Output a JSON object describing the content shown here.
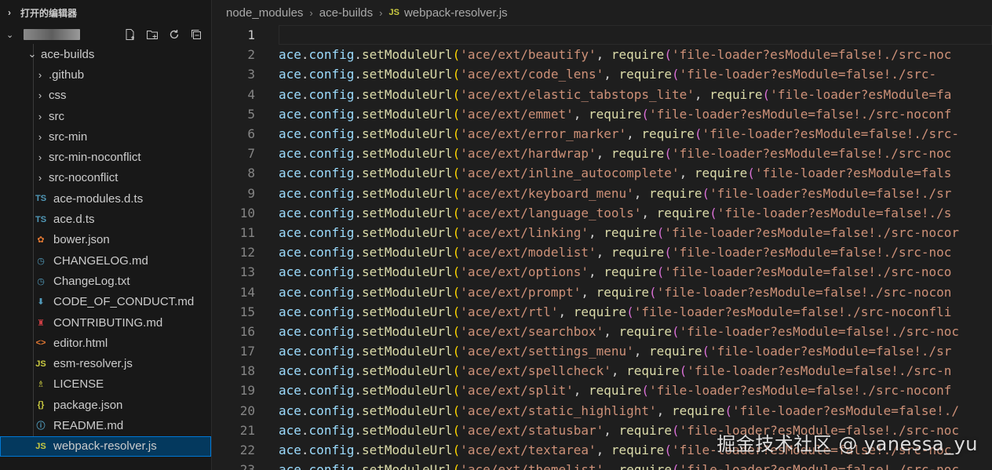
{
  "sidebar": {
    "section_title": "打开的编辑器",
    "actions": [
      "new-file-icon",
      "new-folder-icon",
      "refresh-icon",
      "collapse-all-icon"
    ],
    "folder": "ace-builds",
    "items": [
      {
        "label": ".github",
        "type": "folder"
      },
      {
        "label": "css",
        "type": "folder"
      },
      {
        "label": "src",
        "type": "folder"
      },
      {
        "label": "src-min",
        "type": "folder"
      },
      {
        "label": "src-min-noconflict",
        "type": "folder"
      },
      {
        "label": "src-noconflict",
        "type": "folder"
      },
      {
        "label": "ace-modules.d.ts",
        "type": "ts",
        "icon": "TS",
        "color": "#519aba"
      },
      {
        "label": "ace.d.ts",
        "type": "ts",
        "icon": "TS",
        "color": "#519aba"
      },
      {
        "label": "bower.json",
        "type": "bower",
        "icon": "✿",
        "color": "#e37933"
      },
      {
        "label": "CHANGELOG.md",
        "type": "changelog",
        "icon": "◷",
        "color": "#519aba"
      },
      {
        "label": "ChangeLog.txt",
        "type": "changelog",
        "icon": "◷",
        "color": "#519aba"
      },
      {
        "label": "CODE_OF_CONDUCT.md",
        "type": "conduct",
        "icon": "⬇",
        "color": "#519aba"
      },
      {
        "label": "CONTRIBUTING.md",
        "type": "contrib",
        "icon": "♜",
        "color": "#cc3e44"
      },
      {
        "label": "editor.html",
        "type": "html",
        "icon": "<>",
        "color": "#e37933"
      },
      {
        "label": "esm-resolver.js",
        "type": "js",
        "icon": "JS",
        "color": "#cbcb41"
      },
      {
        "label": "LICENSE",
        "type": "license",
        "icon": "♗",
        "color": "#cbcb41"
      },
      {
        "label": "package.json",
        "type": "json",
        "icon": "{}",
        "color": "#cbcb41"
      },
      {
        "label": "README.md",
        "type": "info",
        "icon": "ⓘ",
        "color": "#519aba"
      },
      {
        "label": "webpack-resolver.js",
        "type": "js",
        "icon": "JS",
        "color": "#cbcb41",
        "selected": true
      }
    ]
  },
  "breadcrumb": [
    "node_modules",
    "ace-builds",
    "webpack-resolver.js"
  ],
  "editor": {
    "active_line": 1,
    "lines": [
      {
        "n": "1",
        "path": ""
      },
      {
        "n": "2",
        "path": "'ace/ext/beautify'",
        "tail": "'file-loader?esModule=false!./src-noc"
      },
      {
        "n": "3",
        "path": "'ace/ext/code_lens'",
        "tail": "'file-loader?esModule=false!./src-"
      },
      {
        "n": "4",
        "path": "'ace/ext/elastic_tabstops_lite'",
        "tail": "'file-loader?esModule=fa"
      },
      {
        "n": "5",
        "path": "'ace/ext/emmet'",
        "tail": "'file-loader?esModule=false!./src-noconf"
      },
      {
        "n": "6",
        "path": "'ace/ext/error_marker'",
        "tail": "'file-loader?esModule=false!./src-"
      },
      {
        "n": "7",
        "path": "'ace/ext/hardwrap'",
        "tail": "'file-loader?esModule=false!./src-noc"
      },
      {
        "n": "8",
        "path": "'ace/ext/inline_autocomplete'",
        "tail": "'file-loader?esModule=fals"
      },
      {
        "n": "9",
        "path": "'ace/ext/keyboard_menu'",
        "tail": "'file-loader?esModule=false!./sr"
      },
      {
        "n": "10",
        "path": "'ace/ext/language_tools'",
        "tail": "'file-loader?esModule=false!./s"
      },
      {
        "n": "11",
        "path": "'ace/ext/linking'",
        "tail": "'file-loader?esModule=false!./src-nocor"
      },
      {
        "n": "12",
        "path": "'ace/ext/modelist'",
        "tail": "'file-loader?esModule=false!./src-noc"
      },
      {
        "n": "13",
        "path": "'ace/ext/options'",
        "tail": "'file-loader?esModule=false!./src-noco"
      },
      {
        "n": "14",
        "path": "'ace/ext/prompt'",
        "tail": "'file-loader?esModule=false!./src-nocon"
      },
      {
        "n": "15",
        "path": "'ace/ext/rtl'",
        "tail": "'file-loader?esModule=false!./src-noconfli"
      },
      {
        "n": "16",
        "path": "'ace/ext/searchbox'",
        "tail": "'file-loader?esModule=false!./src-noc"
      },
      {
        "n": "17",
        "path": "'ace/ext/settings_menu'",
        "tail": "'file-loader?esModule=false!./sr"
      },
      {
        "n": "18",
        "path": "'ace/ext/spellcheck'",
        "tail": "'file-loader?esModule=false!./src-n"
      },
      {
        "n": "19",
        "path": "'ace/ext/split'",
        "tail": "'file-loader?esModule=false!./src-noconf"
      },
      {
        "n": "20",
        "path": "'ace/ext/static_highlight'",
        "tail": "'file-loader?esModule=false!./"
      },
      {
        "n": "21",
        "path": "'ace/ext/statusbar'",
        "tail": "'file-loader?esModule=false!./src-noc"
      },
      {
        "n": "22",
        "path": "'ace/ext/textarea'",
        "tail": "'file-loader?esModule=false!./src-noc"
      },
      {
        "n": "23",
        "path": "'ace/ext/themelist'",
        "tail": "'file-loader?esModule=false!./src-noc"
      }
    ],
    "tokens": {
      "obj": "ace",
      "prop": "config",
      "fn": "setModuleUrl",
      "req": "require"
    }
  },
  "watermark": "掘金技术社区 @ yanessa_yu"
}
